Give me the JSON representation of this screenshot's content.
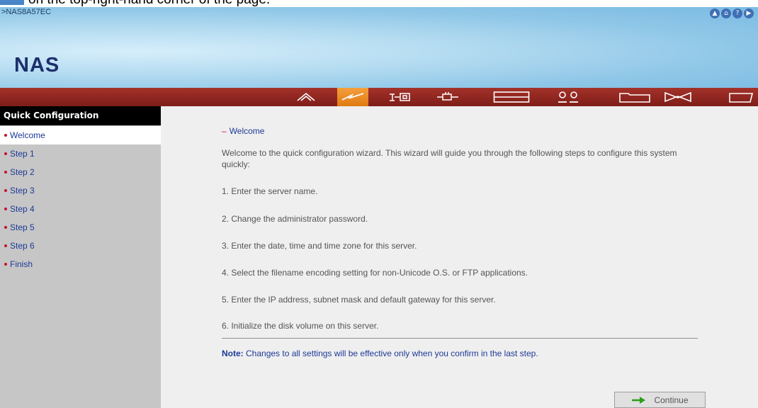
{
  "caption_text": "on the top-right-hand corner of the page.",
  "banner": {
    "hostname": ">NAS8A57EC",
    "logo": "NAS",
    "top_icons": [
      "up-icon",
      "home-icon",
      "help-icon",
      "forward-icon"
    ]
  },
  "nav": {
    "items": [
      "home-icon",
      "quick-config-icon",
      "system-tools-icon",
      "network-icon",
      "disk-icon",
      "users-icon",
      "folder-icon",
      "mail-icon",
      "flag-icon"
    ],
    "active_index": 1
  },
  "sidebar": {
    "title": "Quick Configuration",
    "items": [
      "Welcome",
      "Step 1",
      "Step 2",
      "Step 3",
      "Step 4",
      "Step 5",
      "Step 6",
      "Finish"
    ],
    "active_index": 0
  },
  "main": {
    "section_title": "Welcome",
    "intro": "Welcome to the quick configuration wizard. This wizard will guide you through the following steps to configure this system quickly:",
    "steps": [
      "1. Enter the server name.",
      "2. Change the administrator password.",
      "3. Enter the date, time and time zone for this server.",
      "4. Select the filename encoding setting for non-Unicode O.S. or FTP applications.",
      "5. Enter the IP address, subnet mask and default gateway for this server.",
      "6. Initialize the disk volume on this server."
    ],
    "note_label": "Note:",
    "note_text": " Changes to all settings will be effective only when you confirm in the last step.",
    "continue_label": "Continue"
  },
  "colors": {
    "nav_bar": "#8c2119",
    "nav_active": "#ee8a22",
    "link_blue": "#1d3a96",
    "bullet_red": "#c8102e"
  }
}
